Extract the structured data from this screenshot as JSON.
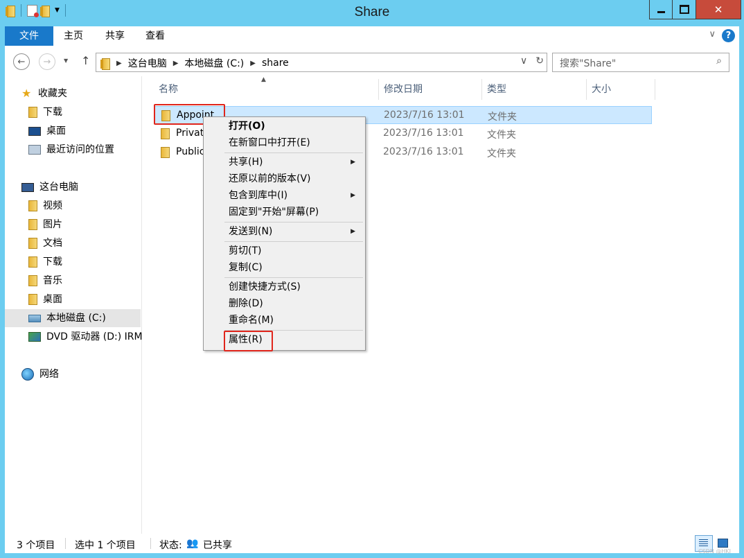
{
  "window": {
    "title": "Share",
    "controls": {
      "minimize": "▁",
      "maximize": "□",
      "close": "✕"
    }
  },
  "ribbon": {
    "tabs": [
      "文件",
      "主页",
      "共享",
      "查看"
    ],
    "help": "?"
  },
  "nav": {
    "breadcrumb": [
      "这台电脑",
      "本地磁盘 (C:)",
      "share"
    ],
    "search_placeholder": "搜索\"Share\""
  },
  "sidebar": {
    "items": [
      {
        "label": "收藏夹",
        "icon": "star-icon"
      },
      {
        "label": "下载",
        "icon": "folder-icon"
      },
      {
        "label": "桌面",
        "icon": "desktop-icon"
      },
      {
        "label": "最近访问的位置",
        "icon": "recent-places-icon"
      },
      {
        "label": "这台电脑",
        "icon": "computer-icon"
      },
      {
        "label": "视频",
        "icon": "folder-icon"
      },
      {
        "label": "图片",
        "icon": "folder-icon"
      },
      {
        "label": "文档",
        "icon": "folder-icon"
      },
      {
        "label": "下载",
        "icon": "folder-icon"
      },
      {
        "label": "音乐",
        "icon": "folder-icon"
      },
      {
        "label": "桌面",
        "icon": "folder-icon"
      },
      {
        "label": "本地磁盘 (C:)",
        "icon": "drive-icon"
      },
      {
        "label": "DVD 驱动器 (D:) IRM",
        "icon": "dvd-icon"
      },
      {
        "label": "网络",
        "icon": "network-icon"
      }
    ]
  },
  "filelist": {
    "columns": [
      "名称",
      "修改日期",
      "类型",
      "大小"
    ],
    "rows": [
      {
        "name": "Appoint",
        "date": "2023/7/16 13:01",
        "type": "文件夹"
      },
      {
        "name": "Privat",
        "date": "2023/7/16 13:01",
        "type": "文件夹"
      },
      {
        "name": "Public",
        "date": "2023/7/16 13:01",
        "type": "文件夹"
      }
    ]
  },
  "context_menu": {
    "items": [
      "打开(O)",
      "在新窗口中打开(E)",
      "共享(H)",
      "还原以前的版本(V)",
      "包含到库中(I)",
      "固定到\"开始\"屏幕(P)",
      "发送到(N)",
      "剪切(T)",
      "复制(C)",
      "创建快捷方式(S)",
      "删除(D)",
      "重命名(M)",
      "属性(R)"
    ]
  },
  "status": {
    "count": "3 个项目",
    "selected": "选中 1 个项目",
    "state_label": "状态:",
    "state_value": "已共享"
  },
  "watermark": "CSDN @HKI"
}
